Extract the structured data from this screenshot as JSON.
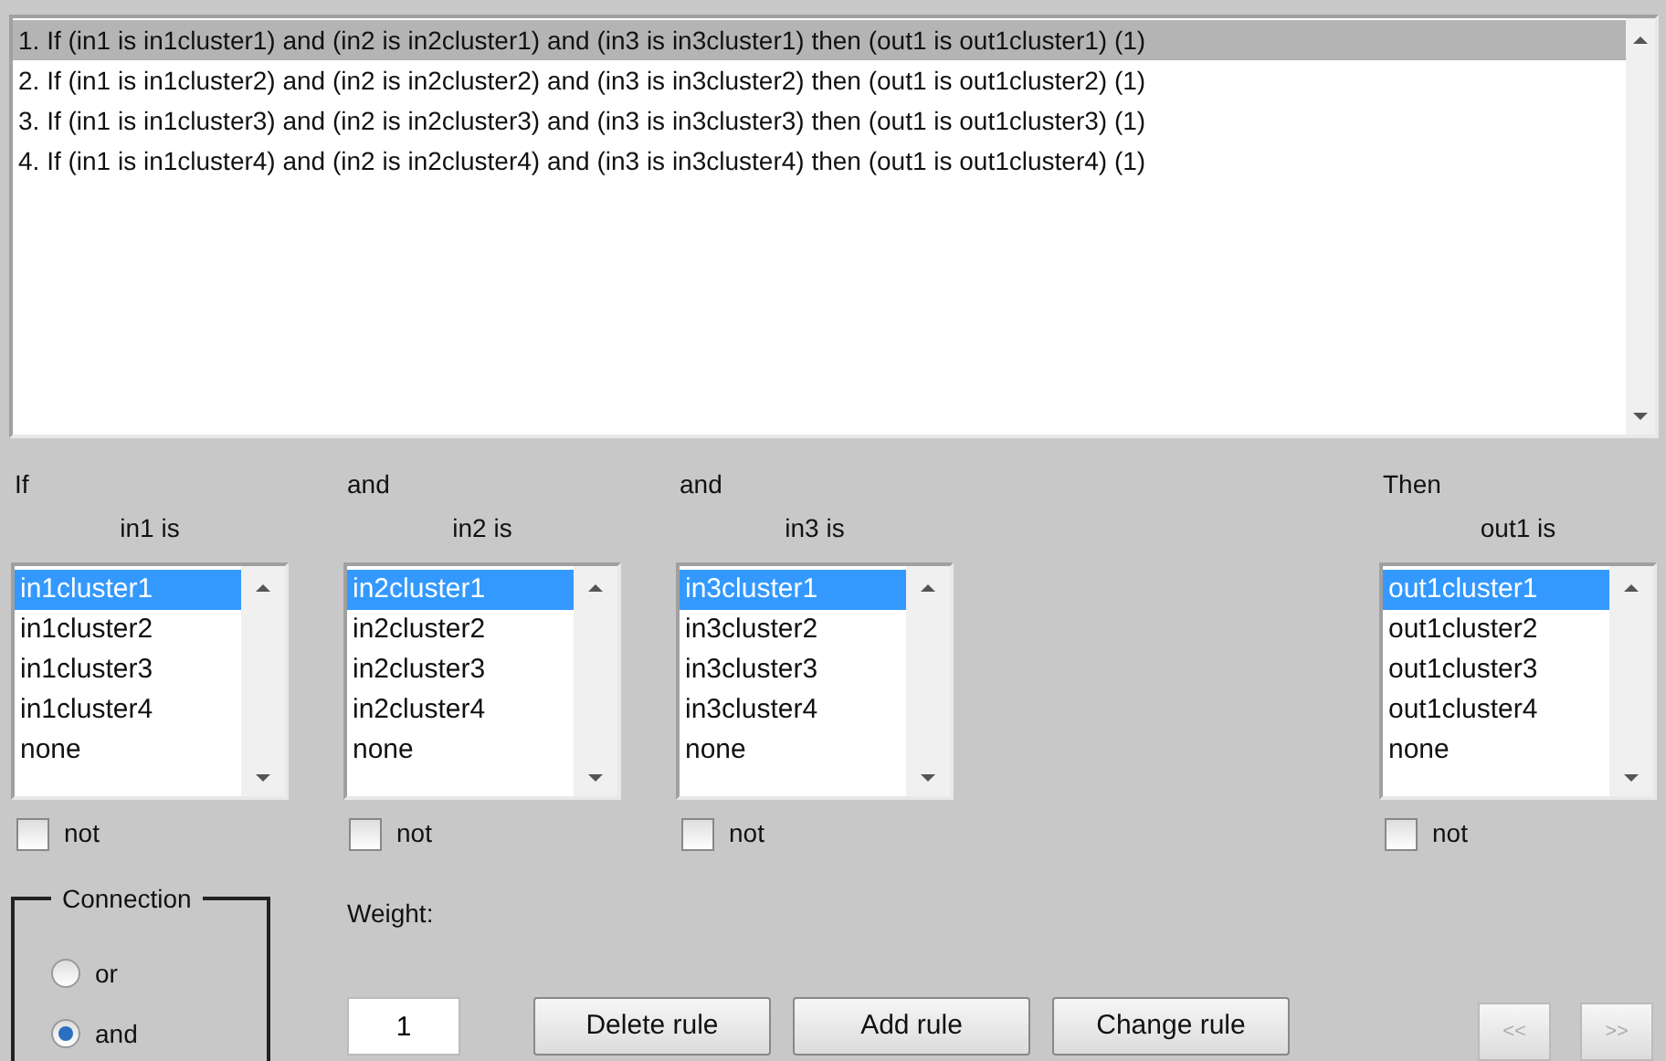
{
  "rules": [
    {
      "text": "1. If (in1 is in1cluster1) and (in2 is in2cluster1) and (in3 is in3cluster1) then (out1 is out1cluster1) (1)",
      "selected": true
    },
    {
      "text": "2. If (in1 is in1cluster2) and (in2 is in2cluster2) and (in3 is in3cluster2) then (out1 is out1cluster2) (1)",
      "selected": false
    },
    {
      "text": "3. If (in1 is in1cluster3) and (in2 is in2cluster3) and (in3 is in3cluster3) then (out1 is out1cluster3) (1)",
      "selected": false
    },
    {
      "text": "4. If (in1 is in1cluster4) and (in2 is in2cluster4) and (in3 is in3cluster4) then (out1 is out1cluster4) (1)",
      "selected": false
    }
  ],
  "clauses": [
    {
      "kind": "input",
      "connective": "If",
      "variable": "in1 is",
      "options": [
        {
          "label": "in1cluster1",
          "selected": true
        },
        {
          "label": "in1cluster2",
          "selected": false
        },
        {
          "label": "in1cluster3",
          "selected": false
        },
        {
          "label": "in1cluster4",
          "selected": false
        },
        {
          "label": "none",
          "selected": false
        }
      ],
      "not_label": "not",
      "not": false
    },
    {
      "kind": "input",
      "connective": "and",
      "variable": "in2 is",
      "options": [
        {
          "label": "in2cluster1",
          "selected": true
        },
        {
          "label": "in2cluster2",
          "selected": false
        },
        {
          "label": "in2cluster3",
          "selected": false
        },
        {
          "label": "in2cluster4",
          "selected": false
        },
        {
          "label": "none",
          "selected": false
        }
      ],
      "not_label": "not",
      "not": false
    },
    {
      "kind": "input",
      "connective": "and",
      "variable": "in3 is",
      "options": [
        {
          "label": "in3cluster1",
          "selected": true
        },
        {
          "label": "in3cluster2",
          "selected": false
        },
        {
          "label": "in3cluster3",
          "selected": false
        },
        {
          "label": "in3cluster4",
          "selected": false
        },
        {
          "label": "none",
          "selected": false
        }
      ],
      "not_label": "not",
      "not": false
    },
    {
      "kind": "output",
      "connective": "Then",
      "variable": "out1 is",
      "options": [
        {
          "label": "out1cluster1",
          "selected": true
        },
        {
          "label": "out1cluster2",
          "selected": false
        },
        {
          "label": "out1cluster3",
          "selected": false
        },
        {
          "label": "out1cluster4",
          "selected": false
        },
        {
          "label": "none",
          "selected": false
        }
      ],
      "not_label": "not",
      "not": false
    }
  ],
  "connection": {
    "title": "Connection",
    "options": [
      {
        "label": "or",
        "selected": false
      },
      {
        "label": "and",
        "selected": true
      }
    ]
  },
  "weight": {
    "label": "Weight:",
    "value": "1"
  },
  "buttons": [
    {
      "label": "Delete rule",
      "disabled": false
    },
    {
      "label": "Add rule",
      "disabled": false
    },
    {
      "label": "Change rule",
      "disabled": false
    }
  ],
  "nav_buttons": [
    {
      "label": "<<",
      "disabled": true
    },
    {
      "label": ">>",
      "disabled": true
    }
  ]
}
